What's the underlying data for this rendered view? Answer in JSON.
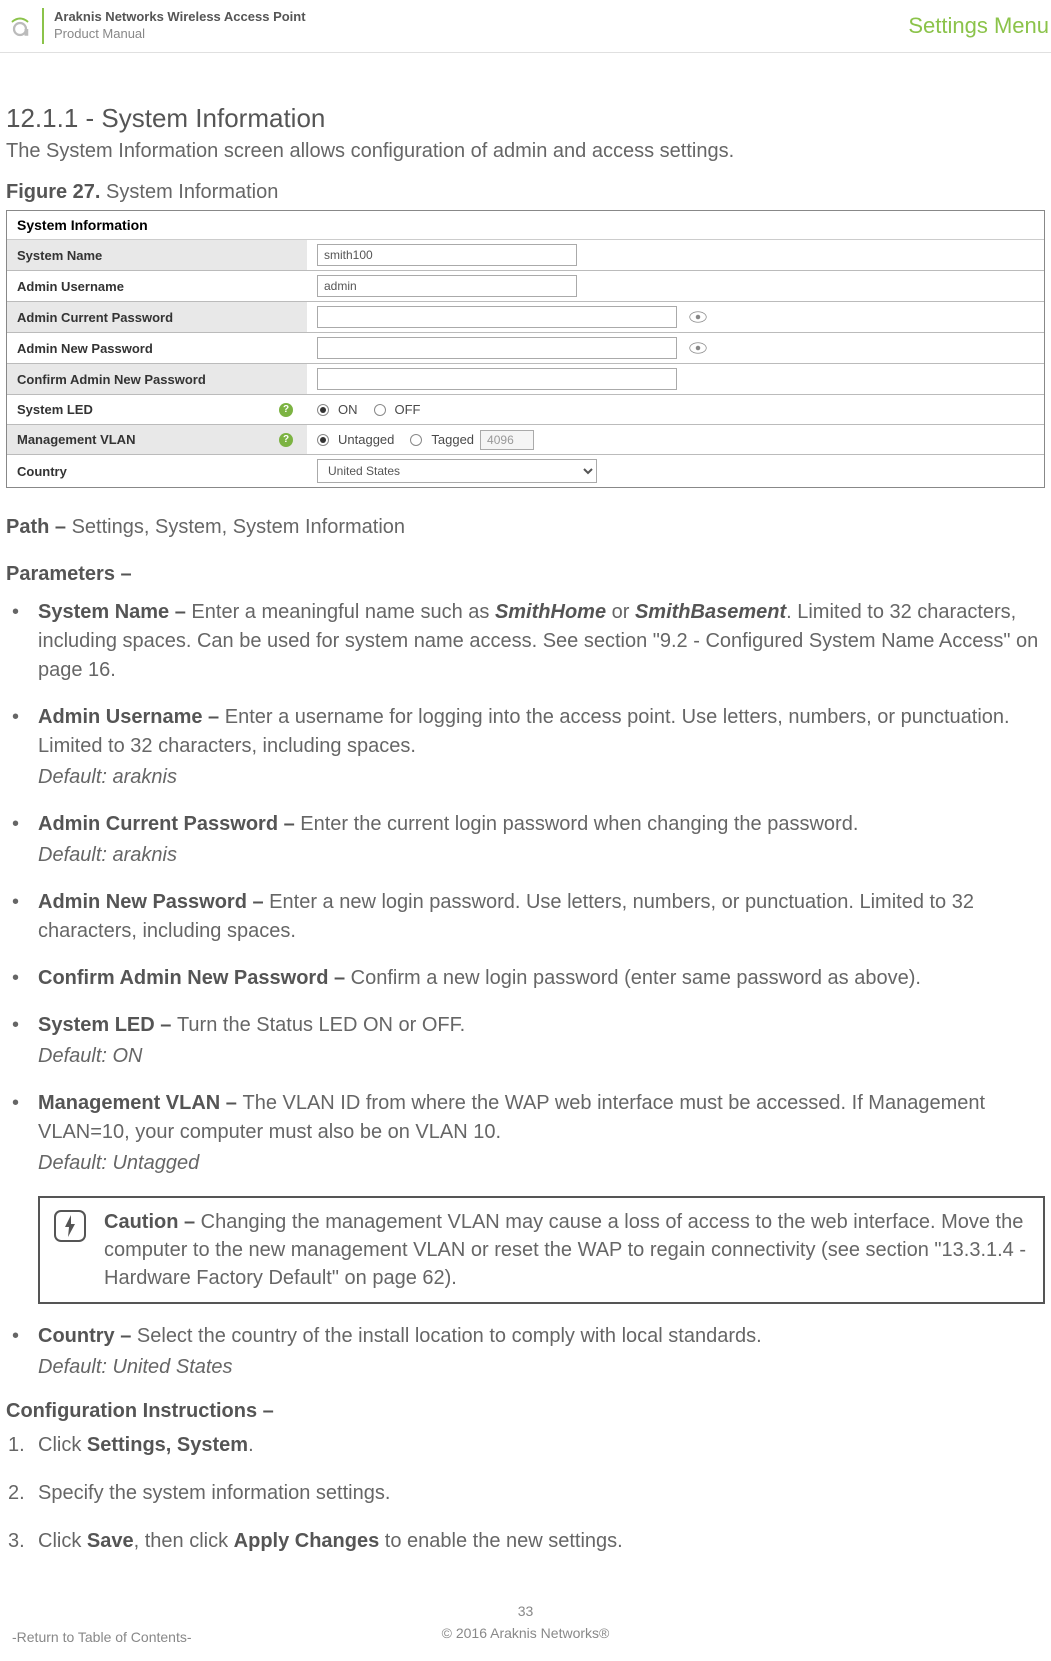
{
  "header": {
    "title": "Araknis Networks Wireless Access Point",
    "subtitle": "Product Manual",
    "right": "Settings Menu"
  },
  "section": {
    "number_title": "12.1.1 - System Information",
    "desc": "The System Information screen allows configuration of admin and access settings."
  },
  "figure": {
    "label": "Figure 27.",
    "title": "System Information"
  },
  "screenshot": {
    "panel_title": "System Information",
    "rows": {
      "system_name": {
        "label": "System Name",
        "value": "smith100"
      },
      "admin_username": {
        "label": "Admin Username",
        "value": "admin"
      },
      "admin_current_pw": {
        "label": "Admin Current Password"
      },
      "admin_new_pw": {
        "label": "Admin New Password"
      },
      "confirm_pw": {
        "label": "Confirm Admin New Password"
      },
      "system_led": {
        "label": "System LED",
        "on": "ON",
        "off": "OFF"
      },
      "mgmt_vlan": {
        "label": "Management VLAN",
        "untagged": "Untagged",
        "tagged": "Tagged",
        "num": "4096"
      },
      "country": {
        "label": "Country",
        "value": "United States"
      }
    }
  },
  "path": {
    "label": "Path –",
    "value": "Settings, System, System Information"
  },
  "params_header": "Parameters –",
  "params": {
    "p1": {
      "label": "System Name – ",
      "t1": "Enter a meaningful name such as ",
      "e1": "SmithHome",
      "t2": " or ",
      "e2": "SmithBasement",
      "t3": ". Limited to 32 characters, including spaces. Can be used for system name access. See section \"9.2 - Configured System Name Access\" on page 16."
    },
    "p2": {
      "label": "Admin Username – ",
      "text": "Enter a username for logging into the access point. Use letters, numbers, or punctuation. Limited to 32 characters, including spaces.",
      "default": "Default: araknis"
    },
    "p3": {
      "label": "Admin Current Password – ",
      "text": "Enter the current login password when changing the password.",
      "default": "Default: araknis"
    },
    "p4": {
      "label": "Admin New Password – ",
      "text": "Enter a new login password. Use letters, numbers, or punctuation. Limited to 32 characters, including spaces."
    },
    "p5": {
      "label": "Confirm Admin New Password – ",
      "text": "Confirm a new login password (enter same password as above)."
    },
    "p6": {
      "label": "System LED – ",
      "text": "Turn the Status LED ON or OFF.",
      "default": "Default: ON"
    },
    "p7": {
      "label": "Management VLAN – ",
      "text": "The VLAN ID from where the WAP web interface must be accessed. If Management VLAN=10, your computer must also be on VLAN 10.",
      "default": "Default: Untagged"
    },
    "caution": {
      "label": "Caution – ",
      "text": "Changing the management VLAN may cause a loss of access to the web interface. Move the computer to the new management VLAN or reset the WAP to regain connectivity (see section \"13.3.1.4 - Hardware Factory Default\" on page 62)."
    },
    "p8": {
      "label": "Country – ",
      "text": "Select the country of the install location to comply with local standards.",
      "default": "Default: United States"
    }
  },
  "ci_header": "Configuration Instructions –",
  "instructions": {
    "s1a": "Click ",
    "s1b": "Settings, System",
    "s1c": ".",
    "s2": "Specify the system information settings.",
    "s3a": "Click ",
    "s3b": "Save",
    "s3c": ", then click ",
    "s3d": "Apply Changes",
    "s3e": " to enable the new settings."
  },
  "footer": {
    "page": "33",
    "toc": "-Return to Table of Contents-",
    "copyright": "© 2016 Araknis Networks®"
  }
}
